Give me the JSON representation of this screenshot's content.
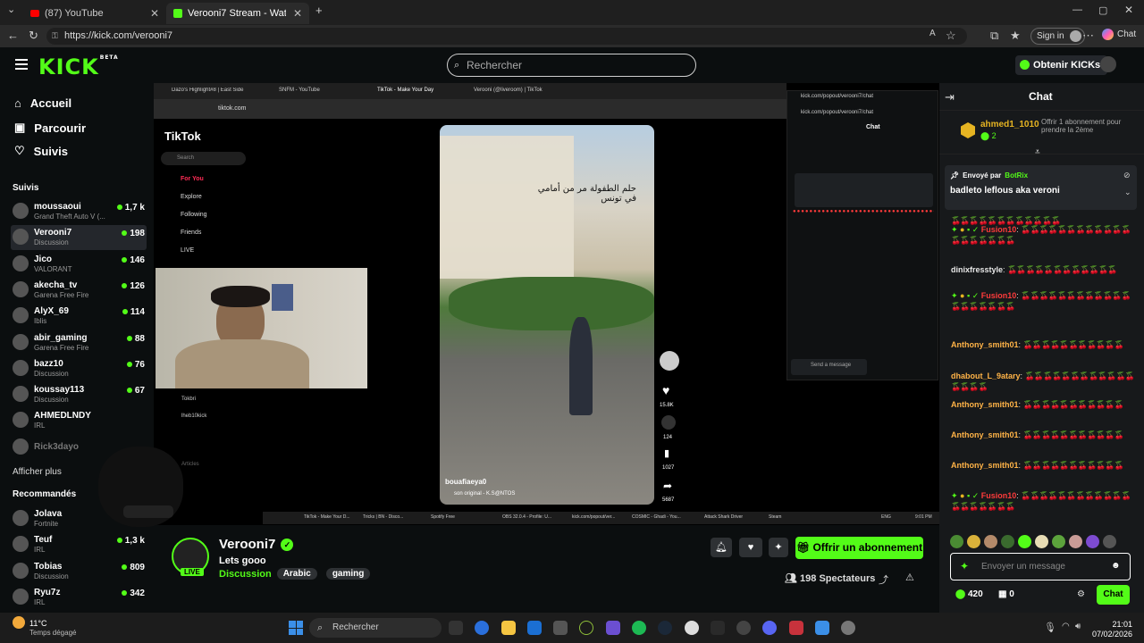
{
  "browser": {
    "tabs": [
      {
        "label": "(87) YouTube"
      },
      {
        "label": "Verooni7 Stream - Watch Live"
      }
    ],
    "url": "https://kick.com/verooni7",
    "signin": "Sign in",
    "chat_btn": "Chat"
  },
  "header": {
    "logo": "KICK",
    "logo_badge": "BETA",
    "search_placeholder": "Rechercher",
    "get_kicks": "Obtenir KICKs"
  },
  "sidebar": {
    "nav": [
      {
        "label": "Accueil",
        "icon": "home-icon"
      },
      {
        "label": "Parcourir",
        "icon": "browse-icon"
      },
      {
        "label": "Suivis",
        "icon": "heart-icon"
      }
    ],
    "following_title": "Suivis",
    "following": [
      {
        "name": "moussaoui",
        "category": "Grand Theft Auto V (...",
        "viewers": "1,7 k"
      },
      {
        "name": "Verooni7",
        "category": "Discussion",
        "viewers": "198"
      },
      {
        "name": "Jico",
        "category": "VALORANT",
        "viewers": "146"
      },
      {
        "name": "akecha_tv",
        "category": "Garena Free Fire",
        "viewers": "126"
      },
      {
        "name": "AlyX_69",
        "category": "Iblis",
        "viewers": "114"
      },
      {
        "name": "abir_gaming",
        "category": "Garena Free Fire",
        "viewers": "88"
      },
      {
        "name": "bazz10",
        "category": "Discussion",
        "viewers": "76"
      },
      {
        "name": "koussay113",
        "category": "Discussion",
        "viewers": "67"
      },
      {
        "name": "AHMEDLNDY",
        "category": "IRL",
        "viewers": ""
      },
      {
        "name": "Rick3dayo",
        "category": "",
        "viewers": ""
      }
    ],
    "show_more": "Afficher plus",
    "recommended_title": "Recommandés",
    "recommended": [
      {
        "name": "Jolava",
        "category": "Fortnite",
        "viewers": ""
      },
      {
        "name": "Teuf",
        "category": "IRL",
        "viewers": "1,3 k"
      },
      {
        "name": "Tobias",
        "category": "Discussion",
        "viewers": "809"
      },
      {
        "name": "Ryu7z",
        "category": "IRL",
        "viewers": "342"
      }
    ]
  },
  "stream": {
    "streamer": "Verooni7",
    "title": "Lets gooo",
    "category": "Discussion",
    "tags": [
      "Arabic",
      "gaming"
    ],
    "live_badge": "LIVE",
    "subscribe": "Offrir un abonnement",
    "viewers": "198 Spectateurs"
  },
  "embedded": {
    "tabs": [
      "Dazo's Highlight#8 | East Side",
      "SNFM - YouTube",
      "TikTok - Make Your Day",
      "Verooni (@liveroom) | TikTok"
    ],
    "url": "tiktok.com",
    "tiktok_logo": "TikTok",
    "tiktok_search": "Search",
    "tiktok_nav": [
      "For You",
      "Explore",
      "Following",
      "Friends",
      "LIVE"
    ],
    "tiktok_accounts": [
      "Tokbri",
      "lheb10kick",
      "Articles"
    ],
    "video_caption": "حلم الطفولة مر من أمامي في تونس",
    "video_user": "bouafiaeya0",
    "video_sound": "son original - K.S@NTOS",
    "counts": [
      "15.8K",
      "124",
      "1027",
      "5687"
    ],
    "popout_url": "kick.com/popout/verooni7/chat",
    "popout_title": "Chat",
    "popout_send": "Send a message",
    "taskbar_items": [
      "TikTok - Make Your D...",
      "Tricks | BN - Disco...",
      "Spotify Free",
      "OBS 32.0.4 - Profile: U...",
      "kick.com/popout/ver...",
      "COSMIC - Ghadi - You...",
      "Attack Shark Driver",
      "Steam"
    ],
    "clock": "9:01 PM",
    "lang": "ENG"
  },
  "chat": {
    "title": "Chat",
    "pinned_user": "ahmed1_1010",
    "pinned_count": "2",
    "pinned_text": "Offrir 1 abonnement pour prendre la 2ème",
    "bot_sent_by": "Envoyé par",
    "bot_name": "BotRix",
    "bot_message": "badleto leflous aka veroni",
    "messages": [
      {
        "user": "",
        "color": "#ffffff",
        "text": "🍒🍒🍒🍒🍒🍒🍒🍒🍒🍒🍒🍒"
      },
      {
        "user": "Fusion10",
        "color": "#ff3b3b",
        "text": "🍒🍒🍒🍒🍒🍒🍒🍒🍒🍒🍒🍒🍒🍒🍒🍒🍒🍒🍒"
      },
      {
        "user": "dinixfresstyle",
        "color": "#e8e8e8",
        "text": "🍒🍒🍒🍒🍒🍒🍒🍒🍒🍒🍒🍒"
      },
      {
        "user": "Fusion10",
        "color": "#ff3b3b",
        "text": "🍒🍒🍒🍒🍒🍒🍒🍒🍒🍒🍒🍒🍒🍒🍒🍒🍒🍒🍒"
      },
      {
        "user": "Anthony_smith01",
        "color": "#ffb347",
        "text": "🍒🍒🍒🍒🍒🍒🍒🍒🍒🍒🍒"
      },
      {
        "user": "dhabout_L_9atary",
        "color": "#ffb347",
        "text": "🍒🍒🍒🍒🍒🍒🍒🍒🍒🍒🍒🍒🍒🍒🍒🍒"
      },
      {
        "user": "Anthony_smith01",
        "color": "#ffb347",
        "text": "🍒🍒🍒🍒🍒🍒🍒🍒🍒🍒🍒"
      },
      {
        "user": "Anthony_smith01",
        "color": "#ffb347",
        "text": "🍒🍒🍒🍒🍒🍒🍒🍒🍒🍒🍒"
      },
      {
        "user": "Anthony_smith01",
        "color": "#ffb347",
        "text": "🍒🍒🍒🍒🍒🍒🍒🍒🍒🍒🍒"
      },
      {
        "user": "Fusion10",
        "color": "#ff3b3b",
        "text": "🍒🍒🍒🍒🍒🍒🍒🍒🍒🍒🍒🍒🍒🍒🍒🍒🍒🍒🍒"
      }
    ],
    "input_placeholder": "Envoyer un message",
    "points": "420",
    "gifts": "0",
    "send": "Chat"
  },
  "taskbar": {
    "weather_temp": "11°C",
    "weather_desc": "Temps dégagé",
    "search": "Rechercher",
    "time": "21:01",
    "date": "07/02/2026"
  },
  "colors": {
    "accent": "#53fc18",
    "bg": "#0b0e0f",
    "chat_bg": "#17191b"
  }
}
